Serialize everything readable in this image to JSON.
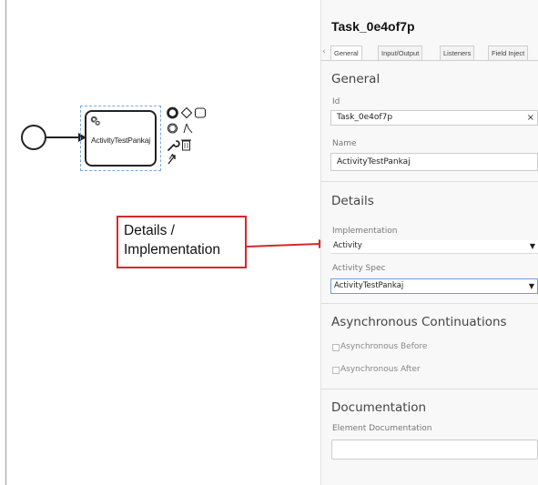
{
  "diagram": {
    "task_label": "ActivityTestPankaj",
    "callout_text": [
      "Details /",
      "Implementation"
    ],
    "accent_color": "#d8262c"
  },
  "panel": {
    "title": "Task_0e4of7p",
    "tabs": [
      "General",
      "Input/Output",
      "Listeners",
      "Field Inject"
    ],
    "active_tab": "General",
    "sections": {
      "general": {
        "heading": "General",
        "id_label": "Id",
        "id_value": "Task_0e4of7p",
        "id_clear": "×",
        "name_label": "Name",
        "name_value": "ActivityTestPankaj"
      },
      "details": {
        "heading": "Details",
        "implementation_label": "Implementation",
        "implementation_value": "Activity",
        "activity_spec_label": "Activity Spec",
        "activity_spec_value": "ActivityTestPankaj"
      },
      "async": {
        "heading": "Asynchronous Continuations",
        "before_label": "Asynchronous Before",
        "before_checked": false,
        "after_label": "Asynchronous After",
        "after_checked": false
      },
      "documentation": {
        "heading": "Documentation",
        "element_doc_label": "Element Documentation",
        "element_doc_value": ""
      }
    }
  }
}
